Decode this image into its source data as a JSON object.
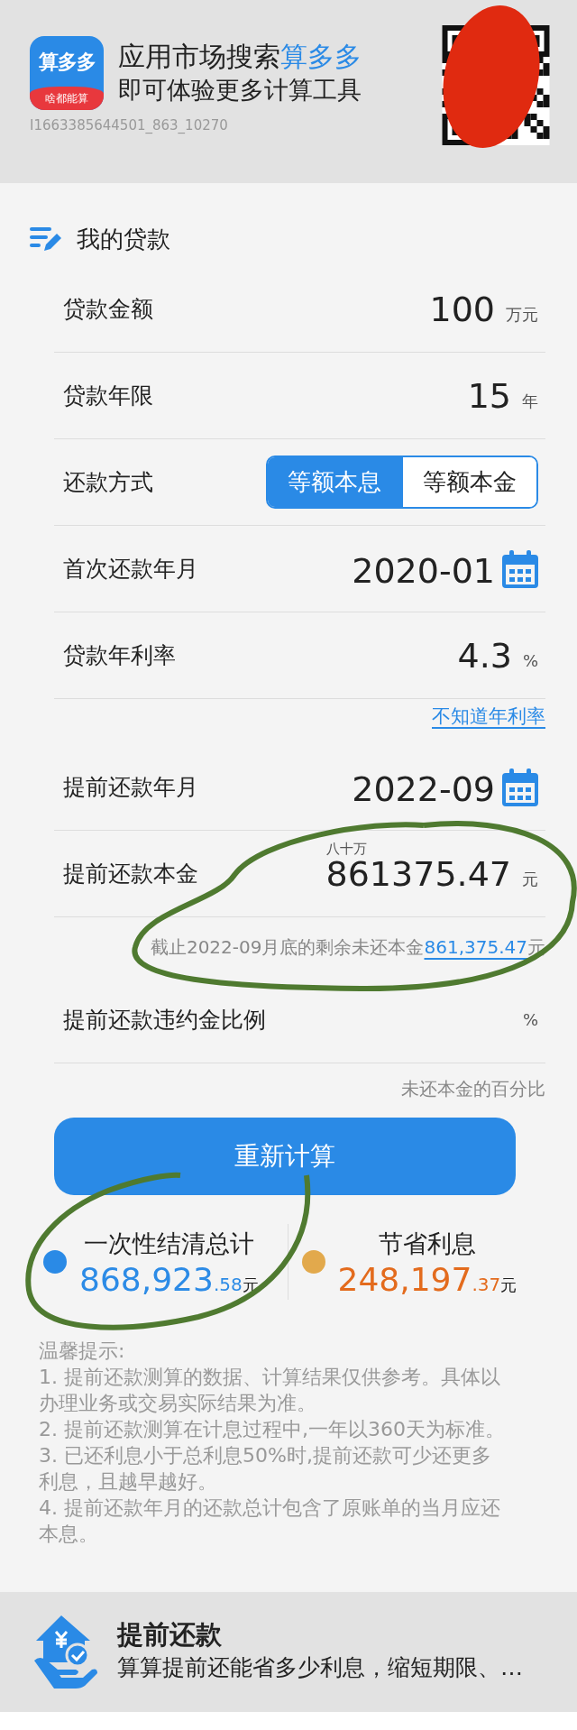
{
  "banner": {
    "logo": {
      "name": "算多多",
      "tagline": "啥都能算"
    },
    "headline": {
      "text": "应用市场搜索",
      "highlight": "算多多"
    },
    "subline": "即可体验更多计算工具",
    "code": "I1663385644501_863_10270"
  },
  "section_title": "我的贷款",
  "rows": [
    {
      "kind": "input",
      "label": "贷款金额",
      "value": "100",
      "unit": "万元"
    },
    {
      "kind": "input",
      "label": "贷款年限",
      "value": "15",
      "unit": "年"
    },
    {
      "kind": "segmented",
      "label": "还款方式",
      "options": [
        {
          "label": "等额本息",
          "selected": true
        },
        {
          "label": "等额本金",
          "selected": false
        }
      ]
    },
    {
      "kind": "date",
      "label": "首次还款年月",
      "value": "2020-01"
    },
    {
      "kind": "input",
      "label": "贷款年利率",
      "value": "4.3",
      "unit": "%"
    },
    {
      "kind": "link",
      "text": "不知道年利率"
    },
    {
      "kind": "date",
      "label": "提前还款年月",
      "value": "2022-09"
    },
    {
      "kind": "input",
      "label": "提前还款本金",
      "value": "861375.47",
      "unit": "元",
      "caption": "八十万"
    },
    {
      "kind": "note",
      "text": "截止2022-09月底的剩余未还本金",
      "link": "861,375.47",
      "suffix": "元"
    },
    {
      "kind": "input",
      "label": "提前还款违约金比例",
      "unit": "%"
    },
    {
      "kind": "hint",
      "text": "未还本金的百分比"
    }
  ],
  "button": "重新计算",
  "results": [
    {
      "kind": "total",
      "label": "一次性结清总计",
      "amount": "868,923",
      "decimal": ".58",
      "unit": "元",
      "color": "#2a8ae6"
    },
    {
      "kind": "savings",
      "label": "节省利息",
      "amount": "248,197",
      "decimal": ".37",
      "unit": "元",
      "color": "#e2a94c"
    }
  ],
  "tips": {
    "title": "温馨提示:",
    "items": [
      "1. 提前还款测算的数据、计算结果仅供参考。具体以办理业务或交易实际结果为准。",
      "2. 提前还款测算在计息过程中,一年以360天为标准。",
      "3. 已还利息小于总利息50%时,提前还款可少还更多利息，且越早越好。",
      "4. 提前还款年月的还款总计包含了原账单的当月应还本息。"
    ]
  },
  "footer": {
    "title": "提前还款",
    "subtitle": "算算提前还能省多少利息，缩短期限、…"
  }
}
